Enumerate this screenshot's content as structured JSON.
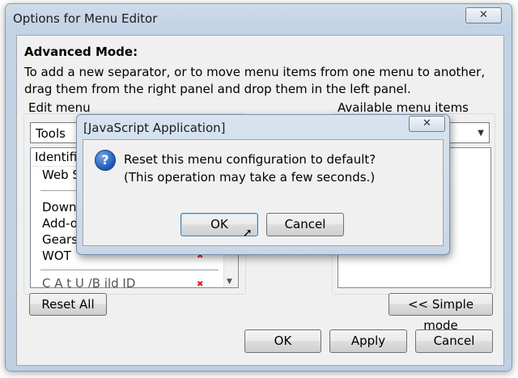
{
  "window": {
    "title": "Options for Menu Editor",
    "close_glyph": "✕"
  },
  "advanced": {
    "title": "Advanced Mode:",
    "description": "To add a new separator, or to move menu items from one menu to another, drag them from the right panel and drop them in the left panel."
  },
  "edit_menu": {
    "label": "Edit menu",
    "selected_menu": "Tools",
    "list_header": "Identific",
    "items": [
      "Web Se",
      "Downlo",
      "Add-or",
      "Gears S",
      "WOT",
      "C         A   t U  /B  ild ID"
    ]
  },
  "available": {
    "label": "Available menu items"
  },
  "buttons": {
    "reset_all": "Reset All",
    "simple_mode": "<< Simple mode",
    "ok": "OK",
    "apply": "Apply",
    "cancel": "Cancel"
  },
  "js_dialog": {
    "title": "[JavaScript Application]",
    "close_glyph": "✕",
    "icon_glyph": "?",
    "line1": "Reset this menu configuration to default?",
    "line2": "(This operation may take a few seconds.)",
    "ok": "OK",
    "cancel": "Cancel"
  },
  "colors": {
    "accent": "#3c7fb1",
    "icon_blue": "#1f56b5",
    "marker_red": "#d02020"
  }
}
